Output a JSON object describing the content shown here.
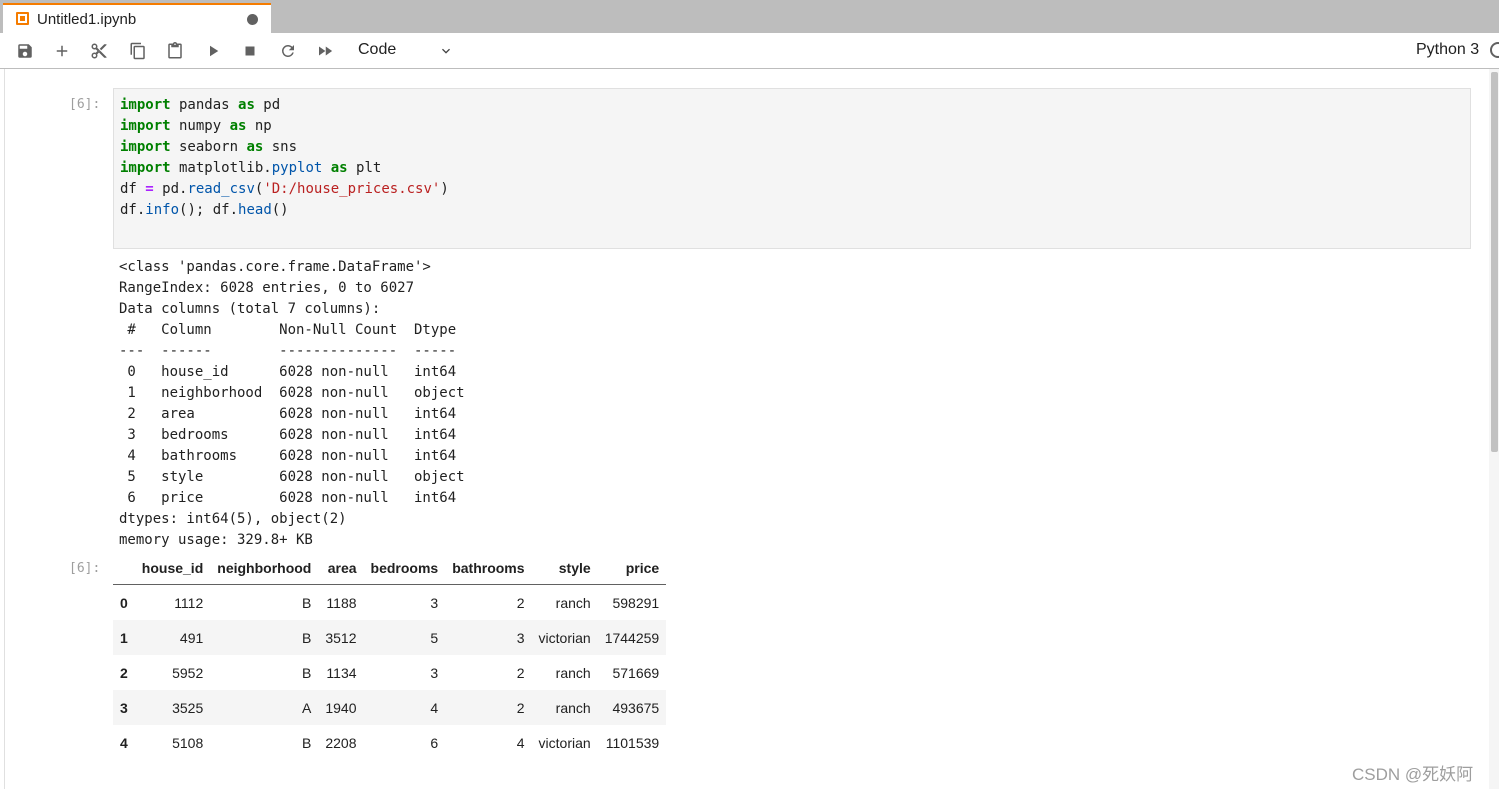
{
  "tab": {
    "title": "Untitled1.ipynb"
  },
  "toolbar": {
    "buttons": [
      "save-icon",
      "add-icon",
      "cut-icon",
      "copy-icon",
      "paste-icon",
      "run-icon",
      "stop-icon",
      "restart-icon",
      "fast-forward-icon"
    ],
    "cell_type": "Code",
    "kernel": "Python 3"
  },
  "cells": {
    "in_prompt": "[6]:",
    "out_prompt": "[6]:",
    "code": [
      "import pandas as pd",
      "import numpy as np",
      "import seaborn as sns",
      "import matplotlib.pyplot as plt",
      "df = pd.read_csv('D:/house_prices.csv')",
      "df.info(); df.head()"
    ],
    "stdout": [
      "<class 'pandas.core.frame.DataFrame'>",
      "RangeIndex: 6028 entries, 0 to 6027",
      "Data columns (total 7 columns):",
      " #   Column        Non-Null Count  Dtype ",
      "---  ------        --------------  ----- ",
      " 0   house_id      6028 non-null   int64 ",
      " 1   neighborhood  6028 non-null   object",
      " 2   area          6028 non-null   int64 ",
      " 3   bedrooms      6028 non-null   int64 ",
      " 4   bathrooms     6028 non-null   int64 ",
      " 5   style         6028 non-null   object",
      " 6   price         6028 non-null   int64 ",
      "dtypes: int64(5), object(2)",
      "memory usage: 329.8+ KB"
    ]
  },
  "dataframe": {
    "columns": [
      "",
      "house_id",
      "neighborhood",
      "area",
      "bedrooms",
      "bathrooms",
      "style",
      "price"
    ],
    "rows": [
      [
        "0",
        "1112",
        "B",
        "1188",
        "3",
        "2",
        "ranch",
        "598291"
      ],
      [
        "1",
        "491",
        "B",
        "3512",
        "5",
        "3",
        "victorian",
        "1744259"
      ],
      [
        "2",
        "5952",
        "B",
        "1134",
        "3",
        "2",
        "ranch",
        "571669"
      ],
      [
        "3",
        "3525",
        "A",
        "1940",
        "4",
        "2",
        "ranch",
        "493675"
      ],
      [
        "4",
        "5108",
        "B",
        "2208",
        "6",
        "4",
        "victorian",
        "1101539"
      ]
    ]
  },
  "watermark": "CSDN @死妖阿"
}
